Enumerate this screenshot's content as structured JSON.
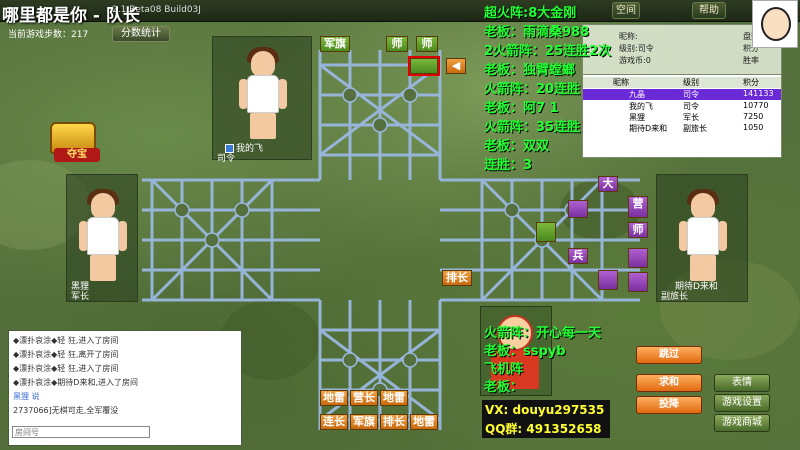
{
  "window": {
    "title": "哪里都是你 - 队长",
    "version": "2.1 Beta08 Build03J"
  },
  "toolbar": {
    "buttons": [
      "空间",
      "帮助"
    ]
  },
  "game": {
    "steps_label": "当前游戏步数：217",
    "stats_button": "分数统计",
    "treasure_label": "夺宝"
  },
  "players": {
    "top": {
      "name": "我的飞",
      "rank": "司令"
    },
    "left": {
      "name": "黑狸",
      "rank": "军长"
    },
    "right": {
      "name": "期待D来和",
      "rank": "副旅长"
    }
  },
  "board": {
    "green_pieces": [
      "军旗",
      "师",
      "师"
    ],
    "orange_pieces_bottom_row1": [
      "地雷",
      "营长",
      "地雷"
    ],
    "orange_pieces_bottom_row2": [
      "连长",
      "军旗",
      "排长",
      "地雷"
    ],
    "orange_mid": "排长",
    "purple_labels": [
      "大",
      "营",
      "师",
      "兵"
    ]
  },
  "overlay_text": {
    "lines": [
      "超火阵:8大金刚",
      "老板：雨滴桑988",
      "2火箭阵：25连胜2次",
      "老板：独臂螳螂",
      "火箭阵：20连胜",
      "老板：阿7 1",
      "火箭阵：35连胜",
      "老板：双双",
      "连胜：3"
    ],
    "bottom_lines": [
      "火箭阵：开心每一天",
      "老板：sspyb",
      "飞机阵",
      "老板："
    ]
  },
  "info_box": {
    "nickname_label": "昵称:",
    "level_label": "级别:",
    "level_value": "司令",
    "games_label": "游戏币:0",
    "right_labels": [
      "盘数",
      "积分",
      "胜率"
    ]
  },
  "player_table": {
    "headers": [
      "昵称",
      "级别",
      "积分"
    ],
    "rows": [
      {
        "name": "九晶",
        "rank": "司令",
        "score": "141133"
      },
      {
        "name": "我的飞",
        "rank": "司令",
        "score": "10770"
      },
      {
        "name": "黑狸",
        "rank": "军长",
        "score": "7250"
      },
      {
        "name": "期待D来和",
        "rank": "副旅长",
        "score": "1050"
      }
    ]
  },
  "chat": {
    "lines": [
      "◆漂扑哀涂◆轻 狂,进入了房间",
      "◆漂扑哀涂◆轻 狂,离开了房间",
      "◆漂扑哀涂◆轻 狂,进入了房间",
      "◆漂扑哀涂◆期待D来和,进入了房间",
      "2737066]无棋可走,全军覆没"
    ],
    "user_label": "黑狸 说",
    "input_placeholder": "房间号"
  },
  "actions": {
    "skip": "跳过",
    "peace": "求和",
    "surrender": "投降",
    "emote": "表情",
    "game_settings": "游戏设置",
    "game_mall": "游戏商城"
  },
  "contact": {
    "vx": "VX: douyu297535",
    "qq": "QQ群: 491352658"
  },
  "colors": {
    "overlay_green": "#22ff33",
    "contact_yellow": "#ffff33",
    "piece_orange": "#e67e22",
    "piece_green": "#5fa82a",
    "piece_purple": "#9040b8"
  }
}
